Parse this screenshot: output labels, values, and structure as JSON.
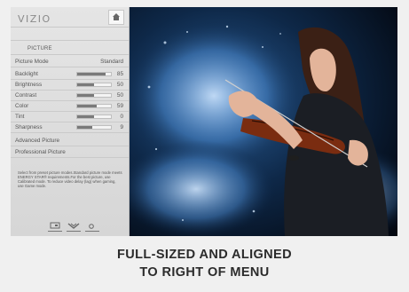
{
  "menu": {
    "brand": "VIZIO",
    "section_title": "PICTURE",
    "picture_mode": {
      "label": "Picture Mode",
      "value": "Standard"
    },
    "settings": [
      {
        "label": "Backlight",
        "value": "85",
        "level": 0.85
      },
      {
        "label": "Brightness",
        "value": "50",
        "level": 0.5
      },
      {
        "label": "Contrast",
        "value": "50",
        "level": 0.5
      },
      {
        "label": "Color",
        "value": "59",
        "level": 0.59
      },
      {
        "label": "Tint",
        "value": "0",
        "level": 0.5
      },
      {
        "label": "Sharpness",
        "value": "9",
        "level": 0.45
      }
    ],
    "links": [
      "Advanced Picture",
      "Professional Picture"
    ],
    "description": "Select from preset picture modes.Standard picture mode meets ENERGY STAR® requirements.For the best picture, use Calibrated mode. To reduce video delay (lag) when gaming, use Game mode."
  },
  "caption": {
    "line1": "FULL-SIZED AND ALIGNED",
    "line2": "TO RIGHT OF MENU"
  },
  "colors": {
    "menu_bg": "#dedede",
    "bar_fill": "#7a7a7a",
    "screen_bg": "#060c16",
    "splash": "#2f6cab"
  },
  "icons": [
    "home-icon",
    "input-icon",
    "wide-icon",
    "closed-caption-icon"
  ]
}
